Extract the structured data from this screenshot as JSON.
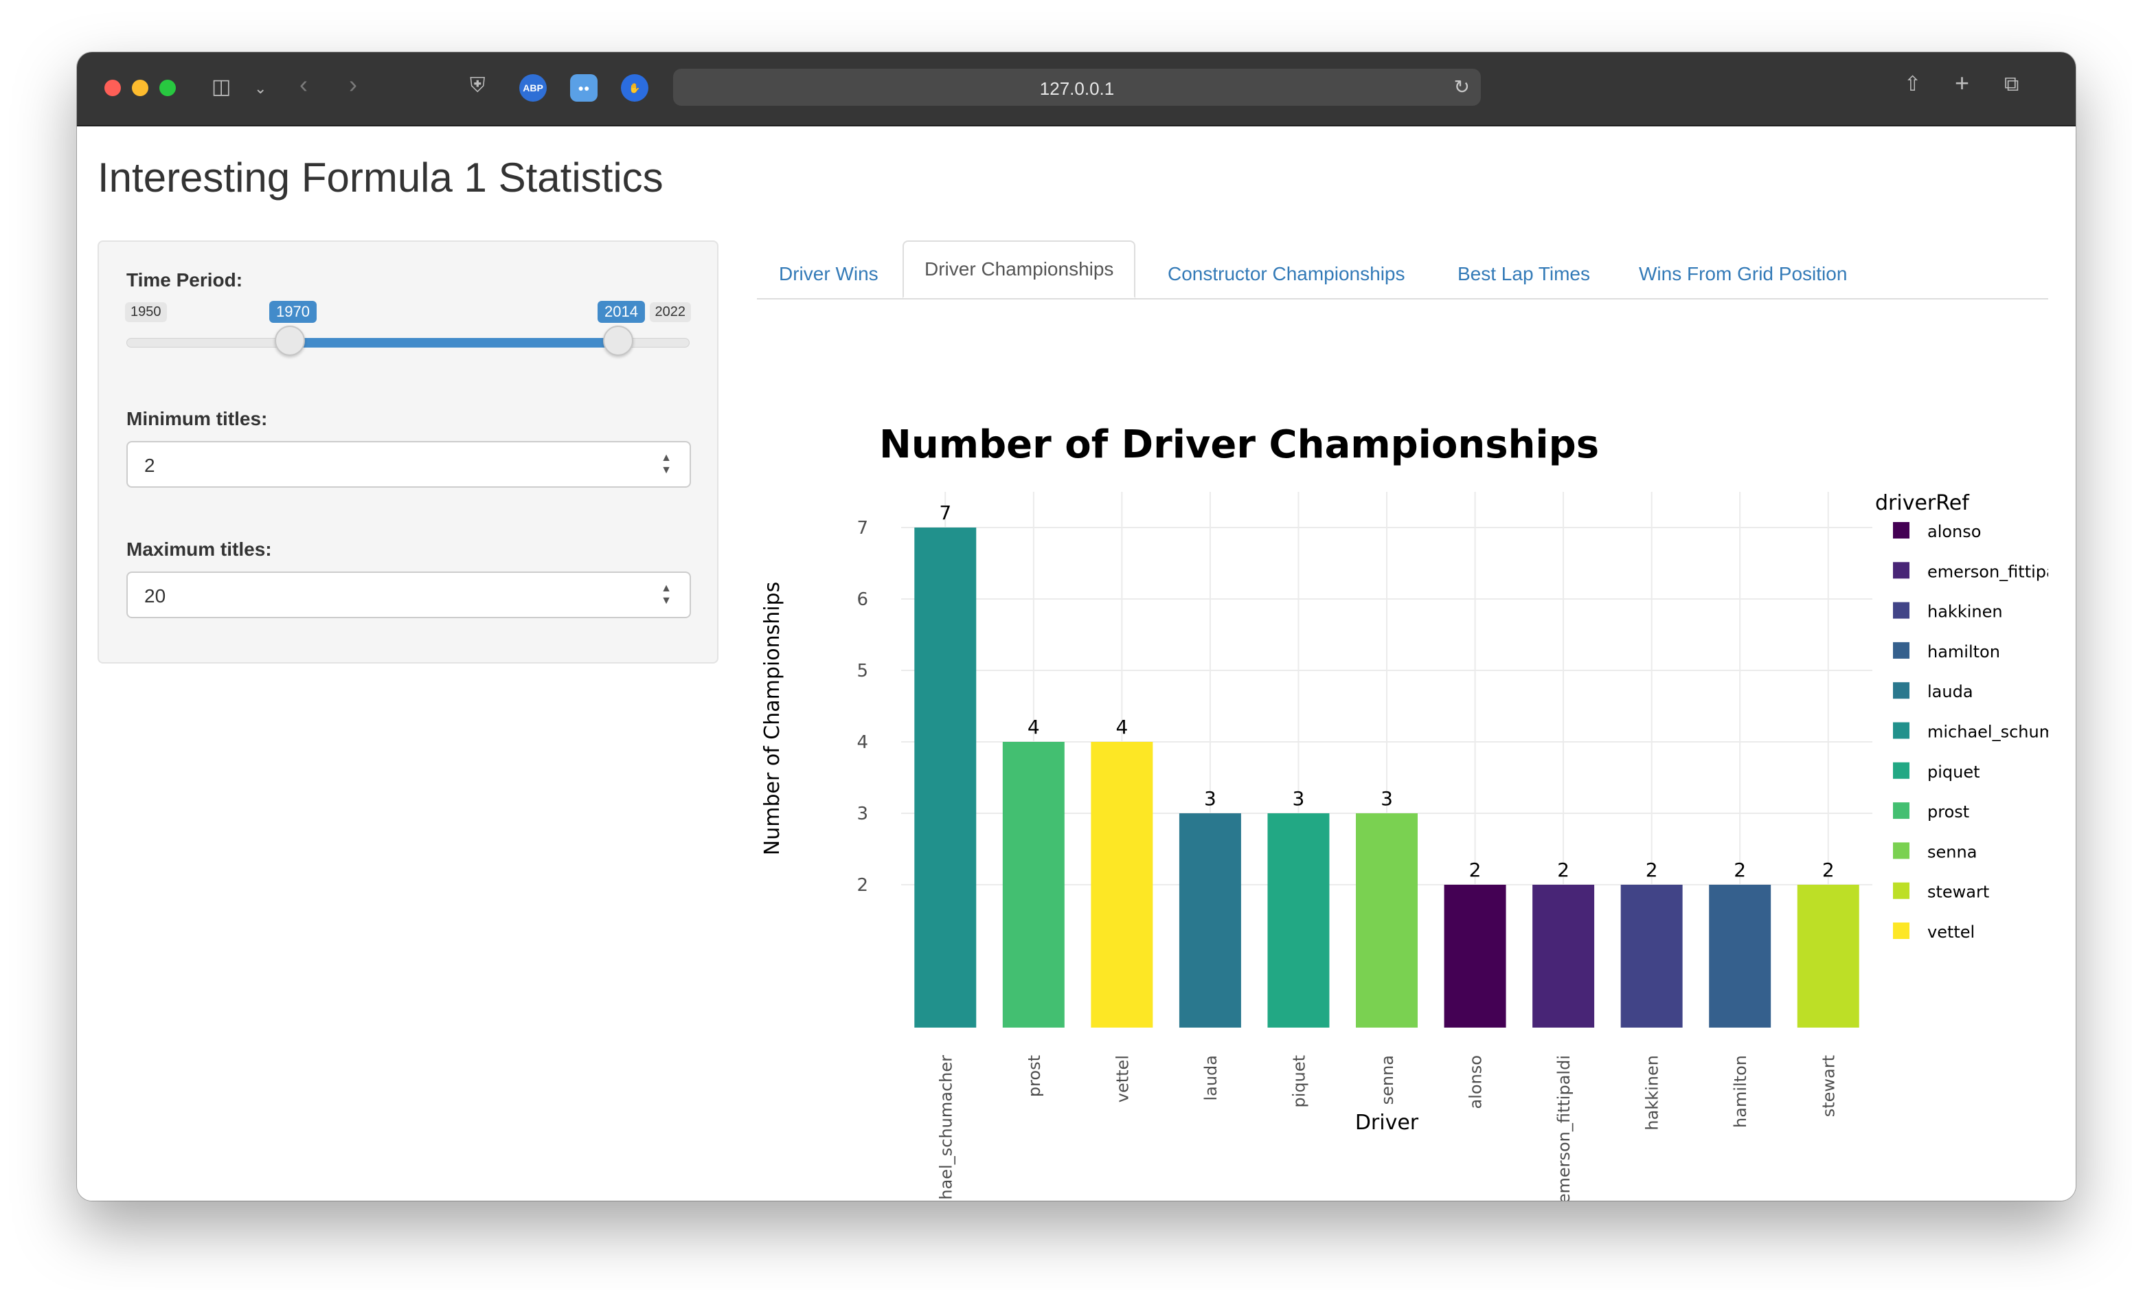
{
  "browser": {
    "url": "127.0.0.1"
  },
  "app": {
    "title": "Interesting Formula 1 Statistics"
  },
  "sidebar": {
    "time_period_label": "Time Period:",
    "slider": {
      "min": "1950",
      "max": "2022",
      "from": "1970",
      "to": "2014"
    },
    "min_titles_label": "Minimum titles:",
    "min_titles_value": "2",
    "max_titles_label": "Maximum titles:",
    "max_titles_value": "20"
  },
  "tabs": [
    {
      "label": "Driver Wins"
    },
    {
      "label": "Driver Championships"
    },
    {
      "label": "Constructor Championships"
    },
    {
      "label": "Best Lap Times"
    },
    {
      "label": "Wins From Grid Position"
    }
  ],
  "chart_data": {
    "type": "bar",
    "title": "Number of Driver Championships",
    "xlabel": "Driver",
    "ylabel": "Number of Championships",
    "categories": [
      "michael_schumacher",
      "prost",
      "vettel",
      "lauda",
      "piquet",
      "senna",
      "alonso",
      "emerson_fittipaldi",
      "hakkinen",
      "hamilton",
      "stewart"
    ],
    "values": [
      7,
      4,
      4,
      3,
      3,
      3,
      2,
      2,
      2,
      2,
      2
    ],
    "yticks": [
      "2",
      "3",
      "4",
      "5",
      "6",
      "7"
    ],
    "ylim": [
      0,
      7.5
    ],
    "grid": true,
    "legend": {
      "title": "driverRef",
      "placement": "right",
      "entries": [
        "alonso",
        "emerson_fittipaldi",
        "hakkinen",
        "hamilton",
        "lauda",
        "michael_schumacher",
        "piquet",
        "prost",
        "senna",
        "stewart",
        "vettel"
      ]
    },
    "colors": {
      "alonso": "#440154",
      "emerson_fittipaldi": "#482576",
      "hakkinen": "#414487",
      "hamilton": "#35608d",
      "lauda": "#2a788e",
      "michael_schumacher": "#21918c",
      "piquet": "#22a884",
      "prost": "#43bf71",
      "senna": "#7ad151",
      "stewart": "#bddf26",
      "vettel": "#fde725"
    }
  }
}
